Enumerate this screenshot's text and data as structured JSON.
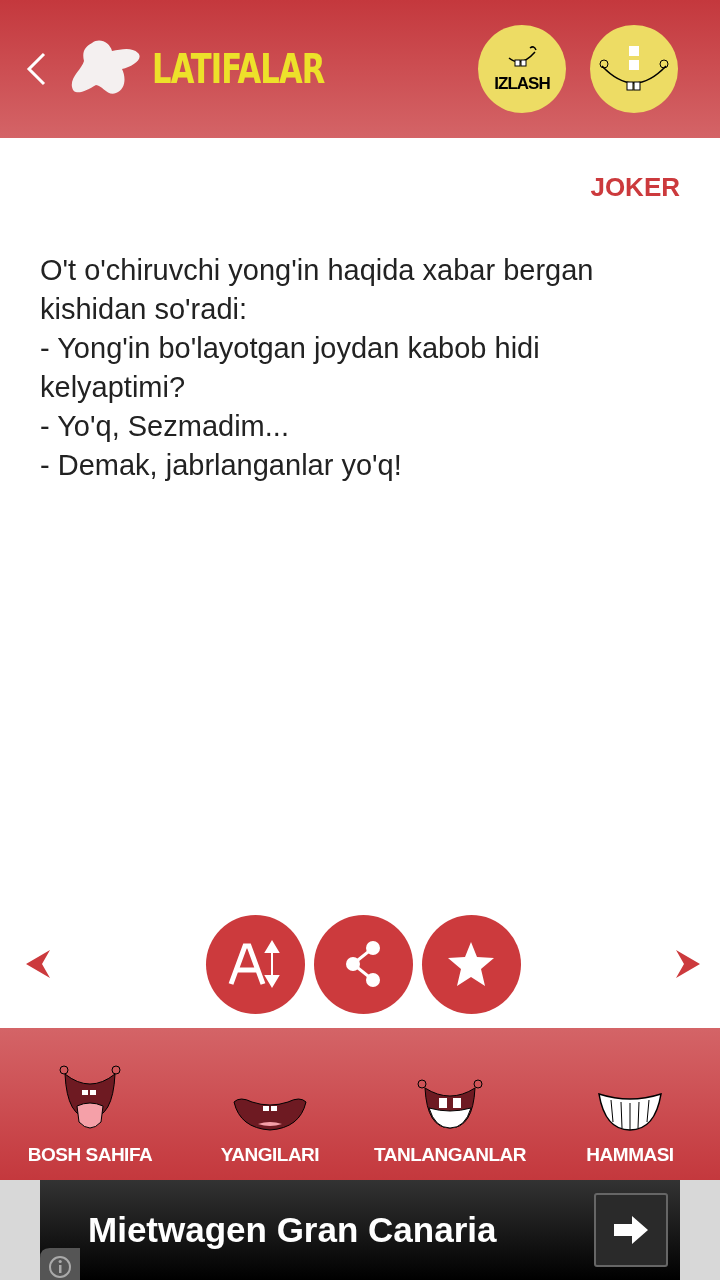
{
  "header": {
    "title": "LATIFALAR",
    "search_label": "IZLASH"
  },
  "joke": {
    "author": "JOKER",
    "lines": [
      "O't o'chiruvchi yong'in haqida xabar bergan kishidan so'radi:",
      "- Yong'in bo'layotgan joydan kabob hidi kelyaptimi?",
      "- Yo'q, Sezmadim...",
      "- Demak, jabrlanganlar yo'q!"
    ]
  },
  "tabs": [
    {
      "label": "BOSH SAHIFA",
      "kind": "tongue"
    },
    {
      "label": "YANGILARI",
      "kind": "lips"
    },
    {
      "label": "TANLANGANLAR",
      "kind": "grin"
    },
    {
      "label": "HAMMASI",
      "kind": "teeth"
    }
  ],
  "ad": {
    "text": "Mietwagen Gran Canaria"
  }
}
